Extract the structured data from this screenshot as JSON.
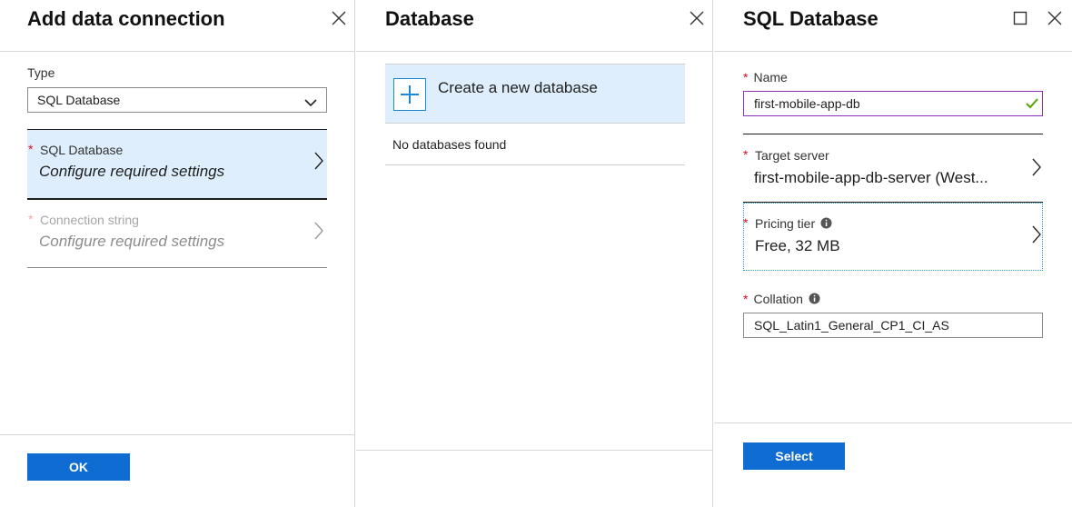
{
  "blade1": {
    "title": "Add data connection",
    "type_label": "Type",
    "type_value": "SQL Database",
    "items": [
      {
        "title": "SQL Database",
        "subtitle": "Configure required settings"
      },
      {
        "title": "Connection string",
        "subtitle": "Configure required settings"
      }
    ],
    "ok_label": "OK"
  },
  "blade2": {
    "title": "Database",
    "create_label": "Create a new database",
    "empty_text": "No databases found"
  },
  "blade3": {
    "title": "SQL Database",
    "name_label": "Name",
    "name_value": "first-mobile-app-db",
    "target_label": "Target server",
    "target_value": "first-mobile-app-db-server (West...",
    "pricing_label": "Pricing tier",
    "pricing_value": "Free, 32 MB",
    "collation_label": "Collation",
    "collation_value": "SQL_Latin1_General_CP1_CI_AS",
    "select_label": "Select"
  },
  "required_marker": "*",
  "colors": {
    "accent": "#0f6cd3",
    "selected_bg": "#deeefc",
    "required": "#e00b1c",
    "valid": "#57a300",
    "input_focus_border": "#8a2fb8"
  }
}
